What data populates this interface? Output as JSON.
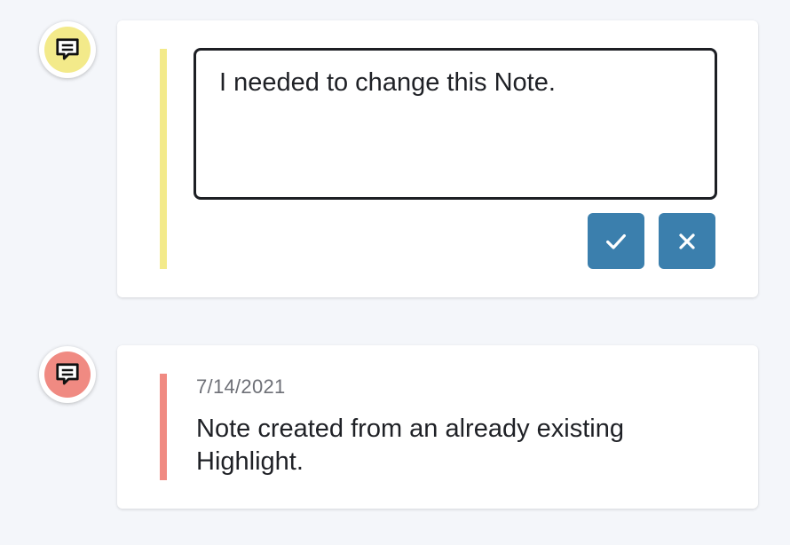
{
  "colors": {
    "background": "#f4f6fa",
    "yellow_note": "#f3ea8a",
    "red_note": "#f08a82",
    "button": "#3b7fad"
  },
  "notes": [
    {
      "mode": "editing",
      "icon": "comment-icon",
      "color": "yellow",
      "input_value": "I needed to change this Note.",
      "save_icon": "check-icon",
      "cancel_icon": "close-icon"
    },
    {
      "mode": "saved",
      "icon": "comment-icon",
      "color": "red",
      "date": "7/14/2021",
      "text": "Note created from an already existing Highlight."
    }
  ]
}
